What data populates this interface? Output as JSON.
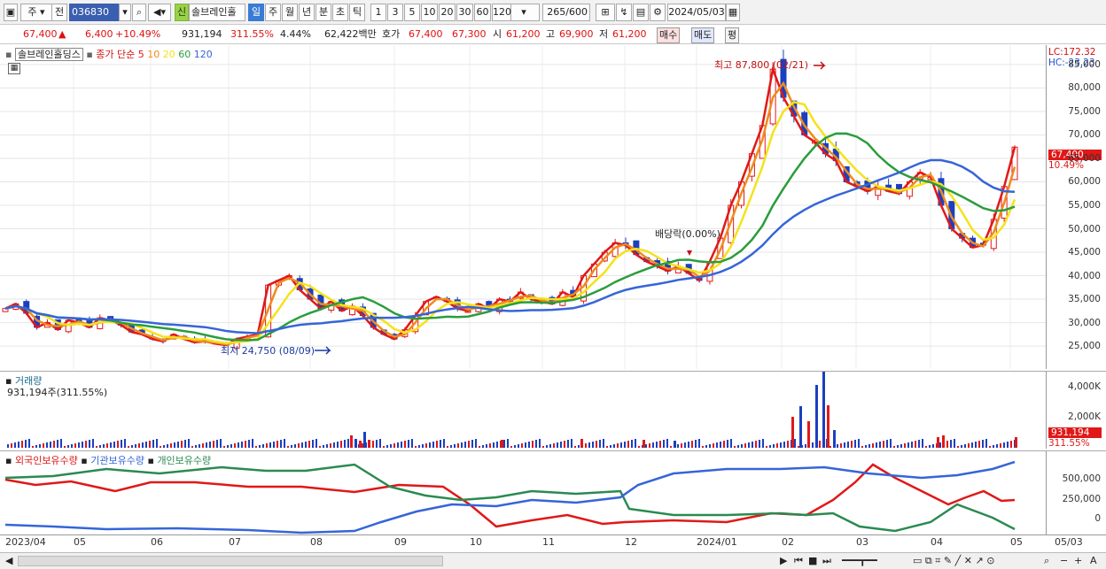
{
  "toolbar": {
    "period_label": "주",
    "prev_label": "전",
    "code": "036830",
    "new_badge": "신",
    "stock_name": "솔브레인홀",
    "tf": [
      "일",
      "주",
      "월",
      "년",
      "분",
      "초",
      "틱"
    ],
    "active_tf": "일",
    "nums": [
      "1",
      "3",
      "5",
      "10",
      "20",
      "30",
      "60",
      "120"
    ],
    "count": "265",
    "count_max": "/600",
    "date": "2024/05/03"
  },
  "info": {
    "price": "67,400",
    "change": "6,400",
    "change_pct": "+10.49%",
    "volume": "931,194",
    "vol_ratio": "311.55%",
    "turnover": "4.44%",
    "amount": "62,422백만",
    "quote_label": "호가",
    "ask": "67,400",
    "bid": "67,300",
    "open_label": "시",
    "open": "61,200",
    "high_label": "고",
    "high": "69,900",
    "low_label": "저",
    "low": "61,200",
    "buy_label": "매수",
    "sell_label": "매도",
    "avg_label": "평"
  },
  "price_pane": {
    "stock_tag": "솔브레인홀딩스",
    "ma_label": "종가 단순",
    "ma": [
      "5",
      "10",
      "20",
      "60",
      "120"
    ],
    "ma_colors": [
      "#e01818",
      "#f08a1c",
      "#f5e21a",
      "#2a9d3c",
      "#3565d8"
    ],
    "lc": "LC:172.32",
    "hc": "HC:-23.23",
    "y_ticks": [
      "85,000",
      "80,000",
      "75,000",
      "70,000",
      "65,000",
      "60,000",
      "55,000",
      "50,000",
      "45,000",
      "40,000",
      "35,000",
      "30,000",
      "25,000"
    ],
    "current_price": "67,400",
    "current_pct": "10.49%",
    "high_note": "최고 87,800 (02/21)",
    "low_note": "최저 24,750 (08/09)",
    "div_note": "배당락(0.00%)"
  },
  "volume_pane": {
    "title": "거래량",
    "value": "931,194주(311.55%)",
    "y_ticks": [
      "4,000K",
      "2,000K"
    ],
    "cur_value": "931,194",
    "cur_pct": "311.55%"
  },
  "holder_pane": {
    "legend": [
      {
        "name": "외국인보유수량",
        "color": "#e01818"
      },
      {
        "name": "기관보유수량",
        "color": "#3565d8"
      },
      {
        "name": "개인보유수량",
        "color": "#2a8a50"
      }
    ],
    "y_ticks": [
      "500,000",
      "250,000",
      "0"
    ]
  },
  "x_labels": [
    "2023/04",
    "05",
    "06",
    "07",
    "08",
    "09",
    "10",
    "11",
    "12",
    "2024/01",
    "02",
    "03",
    "04",
    "05"
  ],
  "x_right": "05/03",
  "chart_data": {
    "type": "candlestick",
    "y_range": [
      22000,
      88000
    ],
    "closes": [
      33000,
      34000,
      32000,
      29000,
      30000,
      28500,
      30500,
      30000,
      29000,
      31000,
      30500,
      29500,
      28000,
      27500,
      26500,
      26000,
      27500,
      26500,
      25800,
      26000,
      25500,
      25200,
      26500,
      27000,
      27500,
      38000,
      39000,
      40000,
      37000,
      35000,
      33000,
      34500,
      32500,
      33500,
      31500,
      29000,
      27500,
      26500,
      28500,
      31500,
      34500,
      35500,
      34500,
      33000,
      32500,
      34000,
      33000,
      35000,
      34500,
      36500,
      35000,
      34500,
      34000,
      36500,
      35500,
      40000,
      42500,
      45000,
      47000,
      46500,
      44500,
      43000,
      42000,
      41000,
      42000,
      40500,
      39000,
      43000,
      48000,
      55000,
      60000,
      66000,
      72000,
      84000,
      78000,
      74000,
      70000,
      68500,
      66000,
      64500,
      60000,
      59000,
      58000,
      59000,
      58000,
      57500,
      60000,
      62000,
      61000,
      55000,
      50000,
      48000,
      46000,
      46500,
      52000,
      59000,
      67400
    ],
    "highlights": {
      "max": "87,800",
      "max_date": "02/21",
      "min": "24,750",
      "min_date": "08/09",
      "div_pct": "0.00%"
    }
  }
}
